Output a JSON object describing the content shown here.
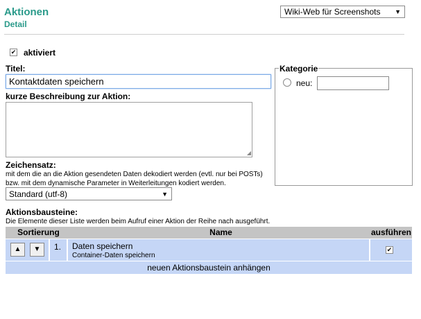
{
  "header": {
    "title": "Aktionen",
    "subtitle": "Detail",
    "site_select": "Wiki-Web für Screenshots"
  },
  "form": {
    "activated_label": "aktiviert",
    "activated": true,
    "title_label": "Titel:",
    "title_value": "Kontaktdaten speichern",
    "description_label": "kurze Beschreibung zur Aktion:",
    "description_value": "",
    "charset_label": "Zeichensatz:",
    "charset_help": "mit dem die an die Aktion gesendeten Daten dekodiert werden (evtl. nur bei POSTs) bzw. mit dem dynamische Parameter in Weiterleitungen kodiert werden.",
    "charset_value": "Standard (utf-8)"
  },
  "category": {
    "legend": "Kategorie",
    "new_label": "neu:",
    "new_value": ""
  },
  "blocks": {
    "label": "Aktionsbausteine:",
    "help": "Die Elemente dieser Liste werden beim Aufruf einer Aktion der Reihe nach ausgeführt.",
    "columns": {
      "sort": "Sortierung",
      "name": "Name",
      "execute": "ausführen"
    },
    "rows": [
      {
        "index": "1.",
        "name": "Daten speichern",
        "detail": "Container-Daten speichern",
        "execute": true
      }
    ],
    "append_label": "neuen Aktionsbaustein anhängen"
  }
}
